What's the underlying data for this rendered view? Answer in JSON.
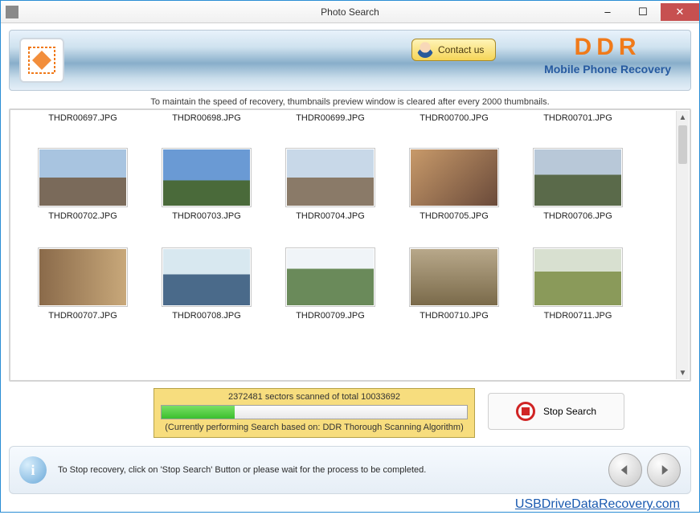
{
  "window": {
    "title": "Photo Search"
  },
  "header": {
    "contact_label": "Contact us",
    "brand_top": "DDR",
    "brand_sub": "Mobile Phone Recovery"
  },
  "notice": "To maintain the speed of recovery, thumbnails preview window is cleared after every 2000 thumbnails.",
  "thumbnails": {
    "row0": [
      {
        "label": "THDR00697.JPG"
      },
      {
        "label": "THDR00698.JPG"
      },
      {
        "label": "THDR00699.JPG"
      },
      {
        "label": "THDR00700.JPG"
      },
      {
        "label": "THDR00701.JPG"
      }
    ],
    "row1": [
      {
        "label": "THDR00702.JPG"
      },
      {
        "label": "THDR00703.JPG"
      },
      {
        "label": "THDR00704.JPG"
      },
      {
        "label": "THDR00705.JPG"
      },
      {
        "label": "THDR00706.JPG"
      }
    ],
    "row2": [
      {
        "label": "THDR00707.JPG"
      },
      {
        "label": "THDR00708.JPG"
      },
      {
        "label": "THDR00709.JPG"
      },
      {
        "label": "THDR00710.JPG"
      },
      {
        "label": "THDR00711.JPG"
      }
    ]
  },
  "progress": {
    "sectors_text": "2372481 sectors scanned of total 10033692",
    "algo_text": "(Currently performing Search based on:  DDR Thorough Scanning Algorithm)",
    "percent": 24
  },
  "stop_label": "Stop Search",
  "footer_hint": "To Stop recovery, click on 'Stop Search' Button or please wait for the process to be completed.",
  "site_link": "USBDriveDataRecovery.com"
}
